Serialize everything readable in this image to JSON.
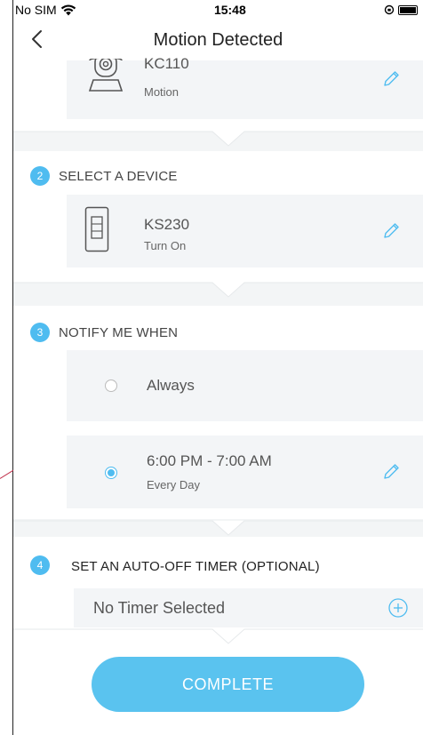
{
  "status": {
    "carrier": "No SIM",
    "time": "15:48"
  },
  "nav": {
    "title": "Motion Detected"
  },
  "trigger": {
    "device": "KC110",
    "action": "Motion"
  },
  "step2": {
    "number": "2",
    "label": "SELECT A DEVICE",
    "device": "KS230",
    "action": "Turn On"
  },
  "step3": {
    "number": "3",
    "label": "NOTIFY ME WHEN",
    "options": [
      {
        "label": "Always",
        "selected": false
      },
      {
        "label": "6:00 PM - 7:00 AM",
        "sub": "Every Day",
        "selected": true
      }
    ]
  },
  "step4": {
    "number": "4",
    "label": "SET AN AUTO-OFF TIMER (OPTIONAL)",
    "value": "No Timer Selected"
  },
  "button": {
    "label": "COMPLETE"
  },
  "colors": {
    "accent": "#4fbcf0",
    "button": "#5ac3ef",
    "card": "#f3f5f7"
  }
}
